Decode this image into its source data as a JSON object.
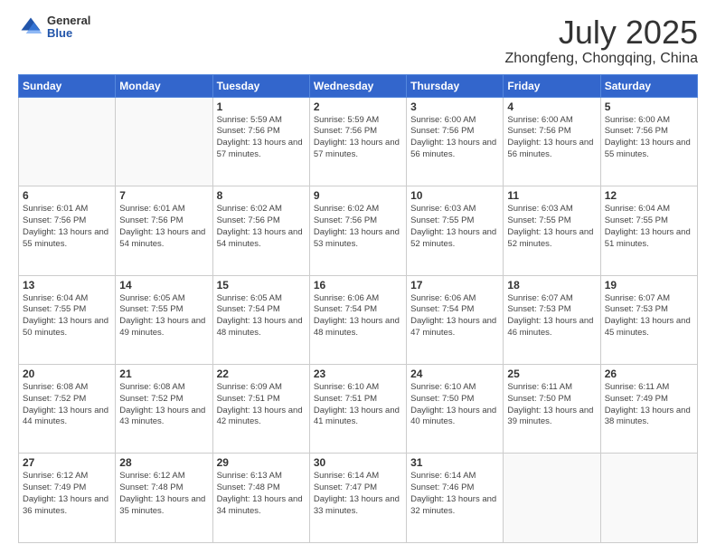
{
  "logo": {
    "general": "General",
    "blue": "Blue"
  },
  "header": {
    "title": "July 2025",
    "subtitle": "Zhongfeng, Chongqing, China"
  },
  "weekdays": [
    "Sunday",
    "Monday",
    "Tuesday",
    "Wednesday",
    "Thursday",
    "Friday",
    "Saturday"
  ],
  "weeks": [
    [
      {
        "day": "",
        "detail": ""
      },
      {
        "day": "",
        "detail": ""
      },
      {
        "day": "1",
        "detail": "Sunrise: 5:59 AM\nSunset: 7:56 PM\nDaylight: 13 hours and 57 minutes."
      },
      {
        "day": "2",
        "detail": "Sunrise: 5:59 AM\nSunset: 7:56 PM\nDaylight: 13 hours and 57 minutes."
      },
      {
        "day": "3",
        "detail": "Sunrise: 6:00 AM\nSunset: 7:56 PM\nDaylight: 13 hours and 56 minutes."
      },
      {
        "day": "4",
        "detail": "Sunrise: 6:00 AM\nSunset: 7:56 PM\nDaylight: 13 hours and 56 minutes."
      },
      {
        "day": "5",
        "detail": "Sunrise: 6:00 AM\nSunset: 7:56 PM\nDaylight: 13 hours and 55 minutes."
      }
    ],
    [
      {
        "day": "6",
        "detail": "Sunrise: 6:01 AM\nSunset: 7:56 PM\nDaylight: 13 hours and 55 minutes."
      },
      {
        "day": "7",
        "detail": "Sunrise: 6:01 AM\nSunset: 7:56 PM\nDaylight: 13 hours and 54 minutes."
      },
      {
        "day": "8",
        "detail": "Sunrise: 6:02 AM\nSunset: 7:56 PM\nDaylight: 13 hours and 54 minutes."
      },
      {
        "day": "9",
        "detail": "Sunrise: 6:02 AM\nSunset: 7:56 PM\nDaylight: 13 hours and 53 minutes."
      },
      {
        "day": "10",
        "detail": "Sunrise: 6:03 AM\nSunset: 7:55 PM\nDaylight: 13 hours and 52 minutes."
      },
      {
        "day": "11",
        "detail": "Sunrise: 6:03 AM\nSunset: 7:55 PM\nDaylight: 13 hours and 52 minutes."
      },
      {
        "day": "12",
        "detail": "Sunrise: 6:04 AM\nSunset: 7:55 PM\nDaylight: 13 hours and 51 minutes."
      }
    ],
    [
      {
        "day": "13",
        "detail": "Sunrise: 6:04 AM\nSunset: 7:55 PM\nDaylight: 13 hours and 50 minutes."
      },
      {
        "day": "14",
        "detail": "Sunrise: 6:05 AM\nSunset: 7:55 PM\nDaylight: 13 hours and 49 minutes."
      },
      {
        "day": "15",
        "detail": "Sunrise: 6:05 AM\nSunset: 7:54 PM\nDaylight: 13 hours and 48 minutes."
      },
      {
        "day": "16",
        "detail": "Sunrise: 6:06 AM\nSunset: 7:54 PM\nDaylight: 13 hours and 48 minutes."
      },
      {
        "day": "17",
        "detail": "Sunrise: 6:06 AM\nSunset: 7:54 PM\nDaylight: 13 hours and 47 minutes."
      },
      {
        "day": "18",
        "detail": "Sunrise: 6:07 AM\nSunset: 7:53 PM\nDaylight: 13 hours and 46 minutes."
      },
      {
        "day": "19",
        "detail": "Sunrise: 6:07 AM\nSunset: 7:53 PM\nDaylight: 13 hours and 45 minutes."
      }
    ],
    [
      {
        "day": "20",
        "detail": "Sunrise: 6:08 AM\nSunset: 7:52 PM\nDaylight: 13 hours and 44 minutes."
      },
      {
        "day": "21",
        "detail": "Sunrise: 6:08 AM\nSunset: 7:52 PM\nDaylight: 13 hours and 43 minutes."
      },
      {
        "day": "22",
        "detail": "Sunrise: 6:09 AM\nSunset: 7:51 PM\nDaylight: 13 hours and 42 minutes."
      },
      {
        "day": "23",
        "detail": "Sunrise: 6:10 AM\nSunset: 7:51 PM\nDaylight: 13 hours and 41 minutes."
      },
      {
        "day": "24",
        "detail": "Sunrise: 6:10 AM\nSunset: 7:50 PM\nDaylight: 13 hours and 40 minutes."
      },
      {
        "day": "25",
        "detail": "Sunrise: 6:11 AM\nSunset: 7:50 PM\nDaylight: 13 hours and 39 minutes."
      },
      {
        "day": "26",
        "detail": "Sunrise: 6:11 AM\nSunset: 7:49 PM\nDaylight: 13 hours and 38 minutes."
      }
    ],
    [
      {
        "day": "27",
        "detail": "Sunrise: 6:12 AM\nSunset: 7:49 PM\nDaylight: 13 hours and 36 minutes."
      },
      {
        "day": "28",
        "detail": "Sunrise: 6:12 AM\nSunset: 7:48 PM\nDaylight: 13 hours and 35 minutes."
      },
      {
        "day": "29",
        "detail": "Sunrise: 6:13 AM\nSunset: 7:48 PM\nDaylight: 13 hours and 34 minutes."
      },
      {
        "day": "30",
        "detail": "Sunrise: 6:14 AM\nSunset: 7:47 PM\nDaylight: 13 hours and 33 minutes."
      },
      {
        "day": "31",
        "detail": "Sunrise: 6:14 AM\nSunset: 7:46 PM\nDaylight: 13 hours and 32 minutes."
      },
      {
        "day": "",
        "detail": ""
      },
      {
        "day": "",
        "detail": ""
      }
    ]
  ]
}
